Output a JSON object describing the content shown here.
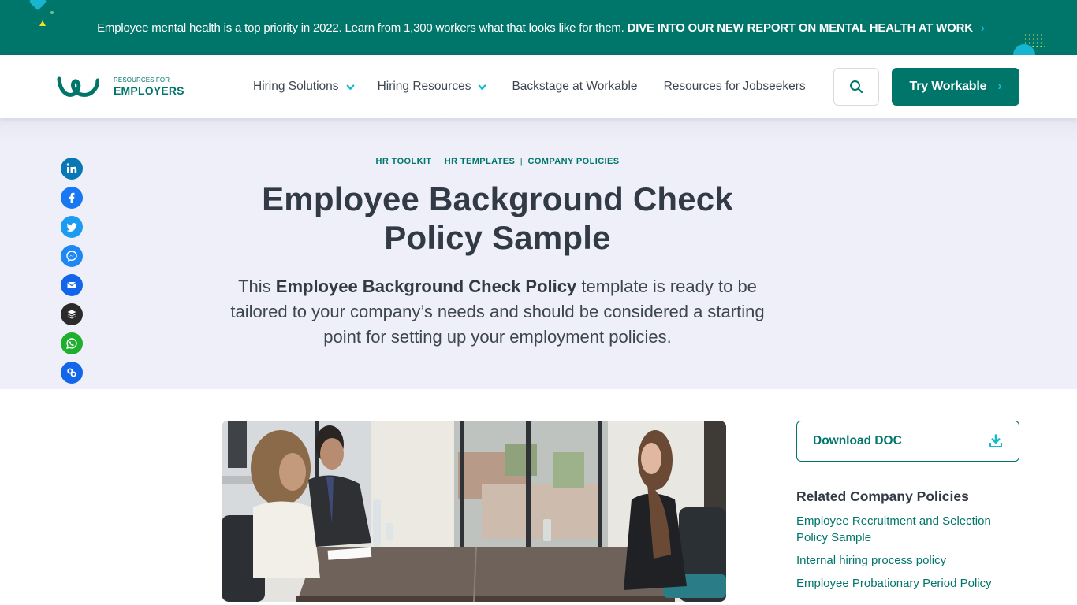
{
  "promo": {
    "text": "Employee mental health is a top priority in 2022. Learn from 1,300 workers what that looks like for them.",
    "cta": "DIVE INTO OUR NEW REPORT ON MENTAL HEALTH AT WORK",
    "chevron": "›"
  },
  "header": {
    "logo_small": "RESOURCES FOR",
    "logo_big": "EMPLOYERS",
    "nav": [
      {
        "label": "Hiring Solutions",
        "has_dropdown": true
      },
      {
        "label": "Hiring Resources",
        "has_dropdown": true
      },
      {
        "label": "Backstage at Workable",
        "has_dropdown": false
      },
      {
        "label": "Resources for Jobseekers",
        "has_dropdown": false
      }
    ],
    "search_icon": "search-icon",
    "cta_label": "Try Workable",
    "cta_arrow": "›"
  },
  "hero": {
    "breadcrumb": [
      "HR TOOLKIT",
      "HR TEMPLATES",
      "COMPANY POLICIES"
    ],
    "breadcrumb_sep": "|",
    "title": "Employee Background Check Policy Sample",
    "intro_prefix": "This ",
    "intro_bold": "Employee Background Check Policy",
    "intro_suffix": " template is ready to be tailored to your company’s needs and should be considered a starting point for setting up your employment policies."
  },
  "share": [
    {
      "name": "linkedin",
      "icon": "linkedin-icon",
      "color": "#0a77b5"
    },
    {
      "name": "facebook",
      "icon": "facebook-icon",
      "color": "#1877f2"
    },
    {
      "name": "twitter",
      "icon": "twitter-icon",
      "color": "#1d9bf0"
    },
    {
      "name": "messenger",
      "icon": "messenger-icon",
      "color": "#1f87f5"
    },
    {
      "name": "email",
      "icon": "email-icon",
      "color": "#1366ea"
    },
    {
      "name": "buffer",
      "icon": "buffer-icon",
      "color": "#2b2b2b"
    },
    {
      "name": "whatsapp",
      "icon": "whatsapp-icon",
      "color": "#1fae2d"
    },
    {
      "name": "copy-link",
      "icon": "link-icon",
      "color": "#1366ea"
    }
  ],
  "main": {
    "image_alt": "Interview at a table: two interviewers facing a candidate by an office window"
  },
  "sidebar": {
    "download_label": "Download DOC",
    "related_title": "Related Company Policies",
    "related_links": [
      "Employee Recruitment and Selection Policy Sample",
      "Internal hiring process policy",
      "Employee Probationary Period Policy"
    ]
  },
  "colors": {
    "brand": "#00756a",
    "accent": "#17b9cf",
    "hero_bg": "#eeeff8",
    "text": "#323b45"
  }
}
